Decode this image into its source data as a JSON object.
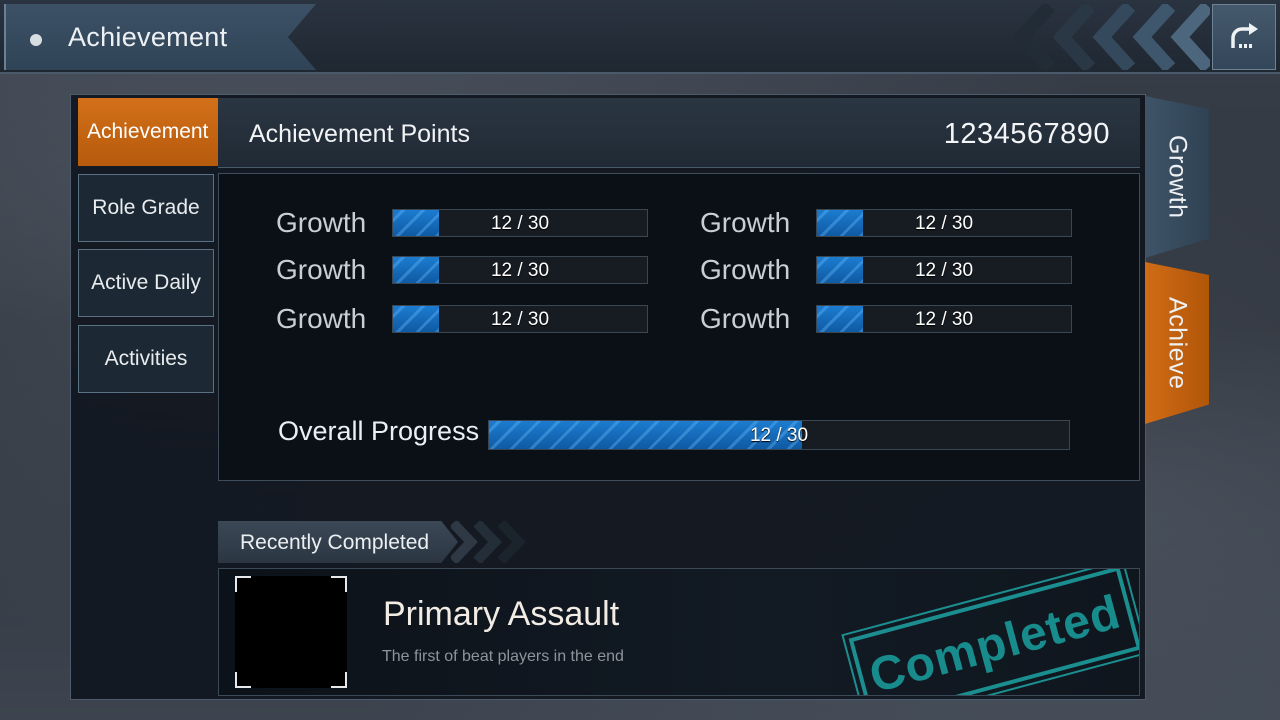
{
  "header": {
    "title": "Achievement"
  },
  "nav": {
    "items": [
      {
        "label": "Achievement",
        "active": true
      },
      {
        "label": "Role Grade",
        "active": false
      },
      {
        "label": "Active Daily",
        "active": false
      },
      {
        "label": "Activities",
        "active": false
      }
    ]
  },
  "points": {
    "label": "Achievement Points",
    "value": "1234567890"
  },
  "stats": [
    {
      "label": "Growth",
      "current": 12,
      "total": 30,
      "text": "12 / 30"
    },
    {
      "label": "Growth",
      "current": 12,
      "total": 30,
      "text": "12 / 30"
    },
    {
      "label": "Growth",
      "current": 12,
      "total": 30,
      "text": "12 / 30"
    },
    {
      "label": "Growth",
      "current": 12,
      "total": 30,
      "text": "12 / 30"
    },
    {
      "label": "Growth",
      "current": 12,
      "total": 30,
      "text": "12 / 30"
    },
    {
      "label": "Growth",
      "current": 12,
      "total": 30,
      "text": "12 / 30"
    }
  ],
  "overall": {
    "label": "Overall Progress",
    "current": 12,
    "total": 30,
    "text": "12 / 30"
  },
  "recent": {
    "header": "Recently Completed",
    "item": {
      "title": "Primary Assault",
      "description": "The first of beat players in the end",
      "stamp": "Completed"
    }
  },
  "side_tabs": {
    "growth": "Growth",
    "achieve": "Achieve"
  },
  "colors": {
    "accent_orange": "#c8661a",
    "progress_blue": "#1a72c2",
    "stamp_teal": "#1ea3a3"
  }
}
